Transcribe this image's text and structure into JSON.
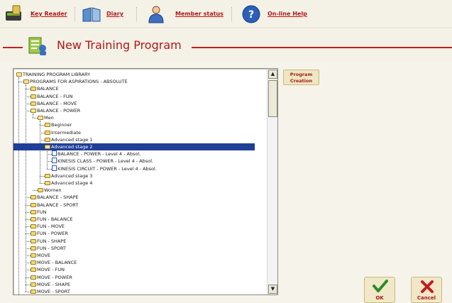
{
  "toolbar": {
    "key_reader": "Key Reader",
    "diary": "Diary",
    "member_status": "Member status",
    "online_help": "On-line Help"
  },
  "page": {
    "title": "New Training Program"
  },
  "buttons": {
    "program_creation_line1": "Program",
    "program_creation_line2": "Creation",
    "ok": "OK",
    "cancel": "Cancel"
  },
  "tree": {
    "nodes": [
      "TRAINING PROGRAM LIBRARY",
      "PROGRAMS FOR ASPIRATIONS - ABSOLUTE",
      "BALANCE",
      "BALANCE - FUN",
      "BALANCE - MOVE",
      "BALANCE - POWER",
      "Men",
      "Beginner",
      "Intermediate",
      "Advanced stage 1",
      "Advanced stage 2",
      "BALANCE - POWER - Level 4 - Absol.",
      "KINESIS CLASS - POWER - Level 4 - Absol.",
      "KINESIS CIRCUIT - POWER - Level 4 - Absol.",
      "Advanced stage 3",
      "Advanced stage 4",
      "Women",
      "BALANCE - SHAPE",
      "BALANCE - SPORT",
      "FUN",
      "FUN - BALANCE",
      "FUN - MOVE",
      "FUN - POWER",
      "FUN - SHAPE",
      "FUN - SPORT",
      "MOVE",
      "MOVE - BALANCE",
      "MOVE - FUN",
      "MOVE - POWER",
      "MOVE - SHAPE",
      "MOVE - SPORT"
    ],
    "selected": "Advanced stage 2"
  }
}
